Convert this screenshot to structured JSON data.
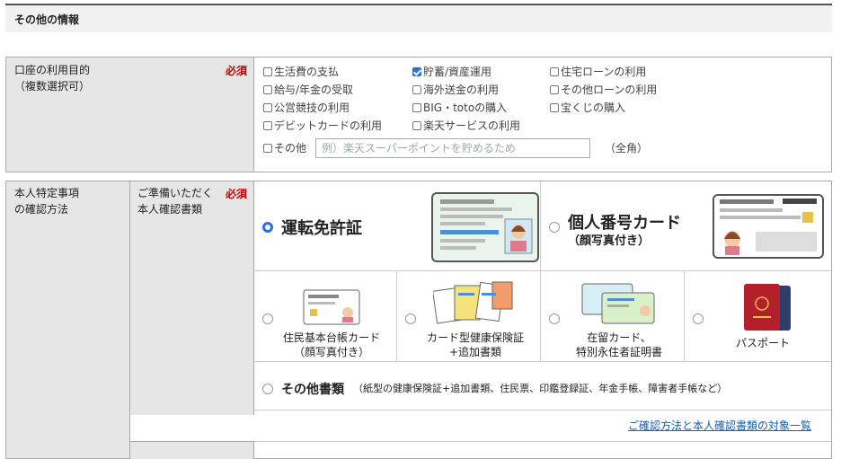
{
  "section_title": "その他の情報",
  "purpose": {
    "label_line1": "口座の利用目的",
    "label_line2": "（複数選択可）",
    "required": "必須",
    "options": [
      {
        "label": "生活費の支払",
        "checked": false
      },
      {
        "label": "貯蓄/資産運用",
        "checked": true
      },
      {
        "label": "住宅ローンの利用",
        "checked": false
      },
      {
        "label": "給与/年金の受取",
        "checked": false
      },
      {
        "label": "海外送金の利用",
        "checked": false
      },
      {
        "label": "その他ローンの利用",
        "checked": false
      },
      {
        "label": "公営競技の利用",
        "checked": false
      },
      {
        "label": "BIG・totoの購入",
        "checked": false
      },
      {
        "label": "宝くじの購入",
        "checked": false
      },
      {
        "label": "デビットカードの利用",
        "checked": false
      },
      {
        "label": "楽天サービスの利用",
        "checked": false
      }
    ],
    "other_label": "その他",
    "other_placeholder": "例）楽天スーパーポイントを貯めるため",
    "other_note": "（全角）"
  },
  "identity": {
    "label_line1": "本人特定事項",
    "label_line2": "の確認方法",
    "sub_label_line1": "ご準備いただく",
    "sub_label_line2": "本人確認書類",
    "required": "必須",
    "docs": {
      "license": "運転免許証",
      "mynumber_line1": "個人番号カード",
      "mynumber_line2": "（顔写真付き）",
      "juki_line1": "住民基本台帳カード",
      "juki_line2": "（顔写真付き）",
      "insurance_line1": "カード型健康保険証",
      "insurance_line2": "+追加書類",
      "residence_line1": "在留カード、",
      "residence_line2": "特別永住者証明書",
      "passport": "パスポート",
      "other_main": "その他書類",
      "other_detail": "（紙型の健康保険証+追加書類、住民票、印鑑登録証、年金手帳、障害者手帳など）"
    },
    "selected": "license",
    "link": "ご確認方法と本人確認書類の対象一覧"
  }
}
